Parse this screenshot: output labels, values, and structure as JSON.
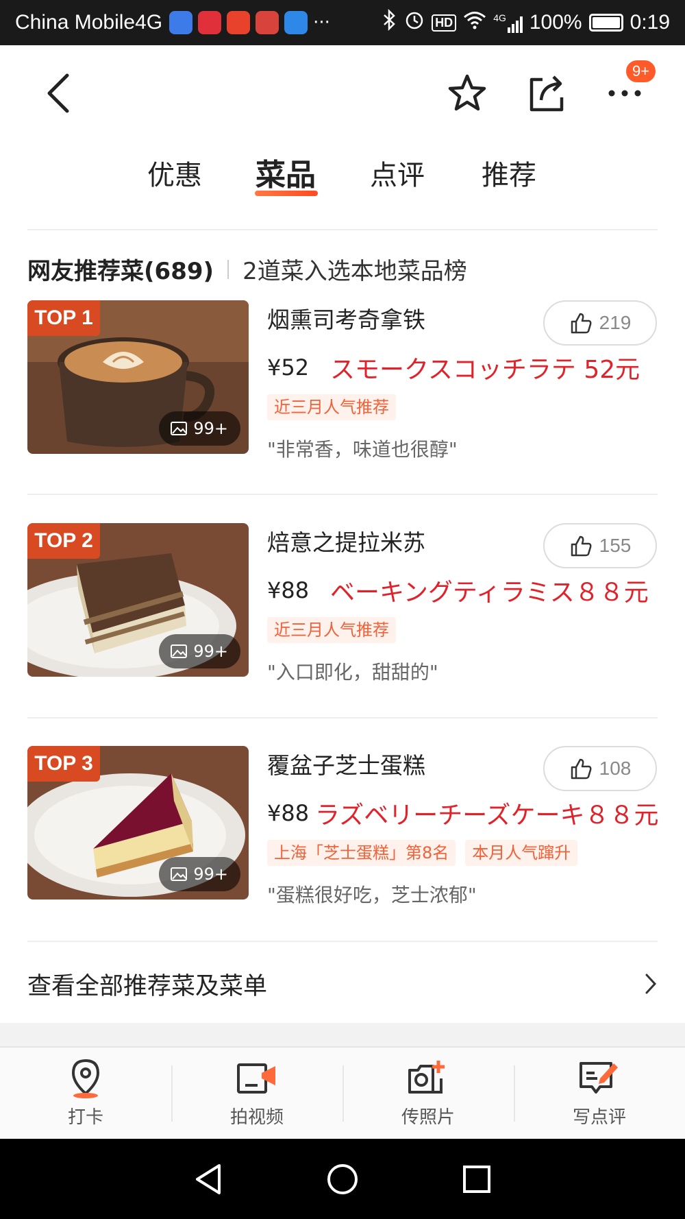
{
  "status_bar": {
    "carrier": "China Mobile4G",
    "apps": [
      "#3d7be8",
      "#e0303a",
      "#e8412c",
      "#d8443c",
      "#2d88e8"
    ],
    "overflow": "···",
    "network": "4G",
    "battery": "100%",
    "time": "0:19"
  },
  "nav": {
    "back_icon": "chevron-left-icon",
    "favorite_icon": "star-icon",
    "share_icon": "share-icon",
    "more_icon": "more-dots-icon",
    "badge": "9+"
  },
  "tabs": [
    {
      "label": "优惠",
      "active": false
    },
    {
      "label": "菜品",
      "active": true
    },
    {
      "label": "点评",
      "active": false
    },
    {
      "label": "推荐",
      "active": false
    }
  ],
  "section": {
    "title": "网友推荐菜(689)",
    "subtitle": "2道菜入选本地菜品榜"
  },
  "dishes": [
    {
      "rank": "TOP 1",
      "name": "烟熏司考奇拿铁",
      "likes": "219",
      "price": "¥52",
      "note": "スモークスコッチラテ 52元",
      "tags": [
        "近三月人气推荐"
      ],
      "quote": "\"非常香，味道也很醇\"",
      "photo_count": "99+"
    },
    {
      "rank": "TOP 2",
      "name": "焙意之提拉米苏",
      "likes": "155",
      "price": "¥88",
      "note": "ベーキングティラミス８８元",
      "tags": [
        "近三月人气推荐"
      ],
      "quote": "\"入口即化，甜甜的\"",
      "photo_count": "99+"
    },
    {
      "rank": "TOP 3",
      "name": "覆盆子芝士蛋糕",
      "likes": "108",
      "price": "¥88",
      "note": "ラズベリーチーズケーキ８８元",
      "tags": [
        "上海「芝士蛋糕」第8名",
        "本月人气蹿升"
      ],
      "quote": "\"蛋糕很好吃，芝士浓郁\"",
      "photo_count": "99+"
    }
  ],
  "see_all": "查看全部推荐菜及菜单",
  "actions": [
    {
      "label": "打卡",
      "icon": "location-pin-icon"
    },
    {
      "label": "拍视频",
      "icon": "video-camera-icon"
    },
    {
      "label": "传照片",
      "icon": "add-photo-icon"
    },
    {
      "label": "写点评",
      "icon": "write-review-icon"
    }
  ],
  "colors": {
    "accent": "#ff5a2a",
    "tag_text": "#f0623a",
    "tag_bg": "#fff1eb",
    "note_red": "#e0232a"
  }
}
